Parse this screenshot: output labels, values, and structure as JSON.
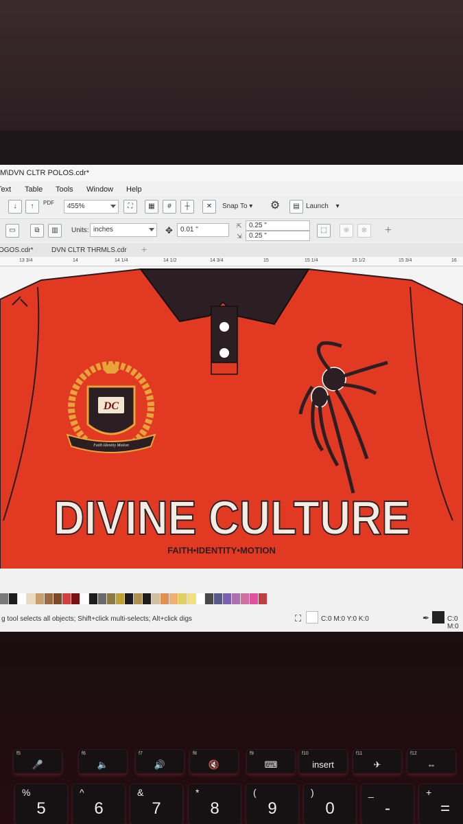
{
  "window": {
    "title": "M\\DVN CLTR POLOS.cdr*"
  },
  "menu": [
    "Text",
    "Table",
    "Tools",
    "Window",
    "Help"
  ],
  "toolbar": {
    "pdf_label": "PDF",
    "zoom": "455%",
    "snap_label": "Snap To",
    "launch_label": "Launch"
  },
  "property_bar": {
    "units_label": "Units:",
    "units_value": "inches",
    "nudge_value": "0.01 \"",
    "dup_x": "0.25 \"",
    "dup_y": "0.25 \""
  },
  "doc_tabs": [
    "OGOS.cdr*",
    "DVN CLTR THRMLS.cdr"
  ],
  "ruler_marks": [
    "13 3/4",
    "14",
    "14 1/4",
    "14 1/2",
    "14 3/4",
    "15",
    "15 1/4",
    "15 1/2",
    "15 3/4",
    "16"
  ],
  "design": {
    "crest_initials": "DC",
    "crest_banner": "Faith  Identity  Motion",
    "brand_name": "DIVINE CULTURE",
    "tagline": "FAITH•IDENTITY•MOTION"
  },
  "palette_colors": [
    "#7a7a7a",
    "#1d1d1d",
    "#ffffff",
    "#e8dcc0",
    "#c8a070",
    "#9a6a40",
    "#7a4a2a",
    "#d04040",
    "#7a1010",
    "#ffffff",
    "#1d1d1d",
    "#6a6a6a",
    "#8a7a40",
    "#c0a030",
    "#1d1d1d",
    "#b09050",
    "#1d1d1d",
    "#d0c0a0",
    "#e09050",
    "#f0b070",
    "#e0d060",
    "#f0e080",
    "#ffffff",
    "#4a4a4a",
    "#5a5a8a",
    "#7a60b0",
    "#b070b0",
    "#d070a0",
    "#e050a0",
    "#c04040"
  ],
  "status": {
    "hint": "g tool selects all objects; Shift+click multi-selects; Alt+click digs",
    "fill_readout": "C:0 M:0 Y:0 K:0",
    "outline_readout": "C:0 M:0"
  },
  "keyboard": {
    "fkeys": [
      {
        "fn": "f5",
        "glyph": "🎤"
      },
      {
        "fn": "f6",
        "glyph": "🔈"
      },
      {
        "fn": "f7",
        "glyph": "🔊"
      },
      {
        "fn": "f8",
        "glyph": "🔇"
      },
      {
        "fn": "f9",
        "glyph": "⌨"
      },
      {
        "fn": "f10",
        "glyph": "insert"
      },
      {
        "fn": "f11",
        "glyph": "✈"
      },
      {
        "fn": "f12",
        "glyph": "⇔"
      }
    ],
    "number_keys": [
      {
        "top": "%",
        "main": "5"
      },
      {
        "top": "^",
        "main": "6"
      },
      {
        "top": "&",
        "main": "7"
      },
      {
        "top": "*",
        "main": "8"
      },
      {
        "top": "(",
        "main": "9"
      },
      {
        "top": ")",
        "main": "0"
      },
      {
        "top": "_",
        "main": "-"
      },
      {
        "top": "+",
        "main": "="
      }
    ]
  }
}
